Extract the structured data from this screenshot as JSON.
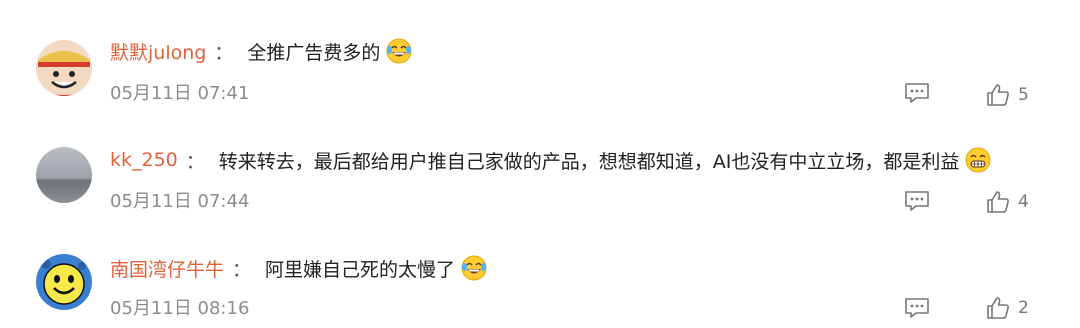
{
  "comments": [
    {
      "username": "默默julong",
      "separator": "：",
      "text": "全推广告费多的",
      "emoji": "laughing-tears-emoji",
      "avatar": "cartoon-pirate-avatar",
      "time": "05月11日 07:41",
      "likes": "5"
    },
    {
      "username": "kk_250",
      "separator": "：",
      "text": "转来转去，最后都给用户推自己家做的产品，想想都知道，AI也没有中立立场，都是利益",
      "emoji": "grinning-emoji",
      "avatar": "grey-sky-avatar",
      "time": "05月11日 07:44",
      "likes": "4"
    },
    {
      "username": "南国湾仔牛牛",
      "separator": "：",
      "text": "阿里嫌自己死的太慢了",
      "emoji": "laughing-tears-emoji",
      "avatar": "yellow-smiley-avatar",
      "time": "05月11日 08:16",
      "likes": "2"
    }
  ],
  "icons": {
    "reply": "comment-icon",
    "like": "thumbs-up-icon"
  },
  "colors": {
    "username": "#e0623c",
    "time": "#8c8c8c",
    "text": "#222222"
  }
}
